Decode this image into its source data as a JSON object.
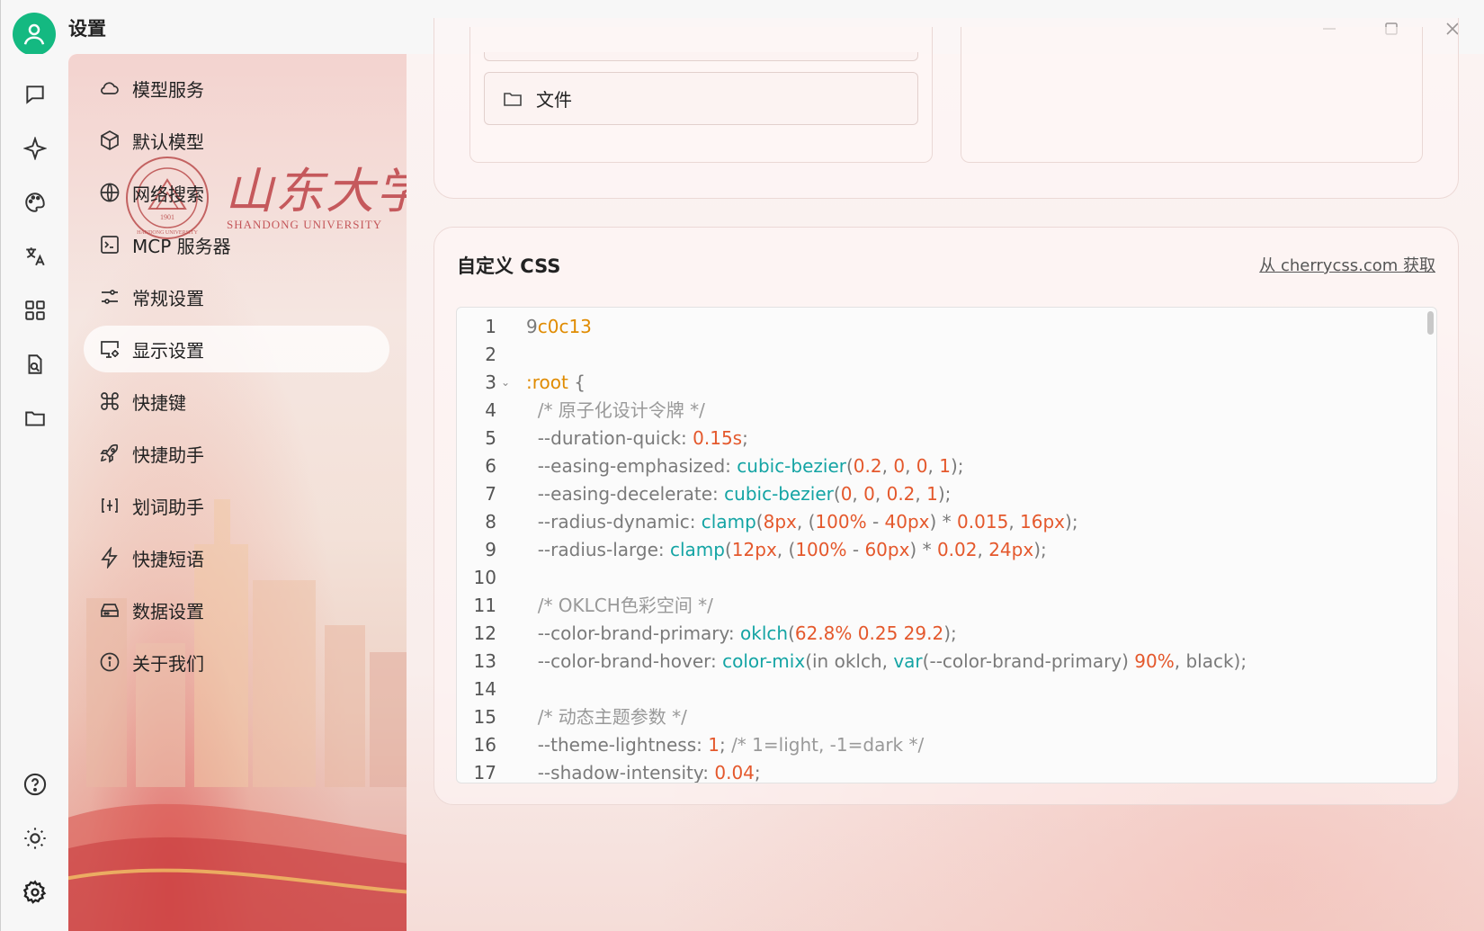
{
  "window": {
    "title": "设置",
    "controls": [
      "minimize-icon",
      "maximize-icon",
      "close-icon"
    ]
  },
  "rail": {
    "top_icons": [
      "chat-icon",
      "sparkle-icon",
      "palette-icon",
      "translate-icon",
      "apps-grid-icon",
      "document-search-icon",
      "folder-icon"
    ],
    "bottom_icons": [
      "help-icon",
      "sun-icon",
      "gear-icon"
    ]
  },
  "nav": {
    "logo_text_cn": "山东大学",
    "logo_text_en": "SHANDONG UNIVERSITY",
    "logo_seal_year": "1901",
    "logo_seal_text": "HANDONG UNIVERSITY",
    "items": [
      {
        "label": "模型服务",
        "icon": "cloud-icon"
      },
      {
        "label": "默认模型",
        "icon": "cube-icon"
      },
      {
        "label": "网络搜索",
        "icon": "globe-icon"
      },
      {
        "label": "MCP 服务器",
        "icon": "terminal-icon"
      },
      {
        "label": "常规设置",
        "icon": "sliders-icon"
      },
      {
        "label": "显示设置",
        "icon": "monitor-settings-icon",
        "active": true
      },
      {
        "label": "快捷键",
        "icon": "command-icon"
      },
      {
        "label": "快捷助手",
        "icon": "rocket-icon"
      },
      {
        "label": "划词助手",
        "icon": "text-select-icon"
      },
      {
        "label": "快捷短语",
        "icon": "zap-icon"
      },
      {
        "label": "数据设置",
        "icon": "hard-drive-icon"
      },
      {
        "label": "关于我们",
        "icon": "info-icon"
      }
    ]
  },
  "top_section": {
    "files_label": "文件"
  },
  "custom_css": {
    "title": "自定义 CSS",
    "link_label": "从 cherrycss.com 获取",
    "lines": [
      {
        "n": "1",
        "parts": [
          [
            "",
            "9"
          ],
          [
            "sel",
            "c0c13"
          ]
        ]
      },
      {
        "n": "2",
        "parts": []
      },
      {
        "n": "3",
        "fold": true,
        "parts": [
          [
            "sel",
            ":root"
          ],
          [
            "",
            " {"
          ]
        ]
      },
      {
        "n": "4",
        "parts": [
          [
            "cm",
            "  /* 原子化设计令牌 */"
          ]
        ]
      },
      {
        "n": "5",
        "parts": [
          [
            "",
            "  --duration-quick: "
          ],
          [
            "num",
            "0.15s"
          ],
          [
            "",
            ";"
          ]
        ]
      },
      {
        "n": "6",
        "parts": [
          [
            "",
            "  --easing-emphasized: "
          ],
          [
            "fn",
            "cubic-bezier"
          ],
          [
            "",
            "("
          ],
          [
            "num",
            "0.2"
          ],
          [
            "",
            ", "
          ],
          [
            "num",
            "0"
          ],
          [
            "",
            ", "
          ],
          [
            "num",
            "0"
          ],
          [
            "",
            ", "
          ],
          [
            "num",
            "1"
          ],
          [
            "",
            ");"
          ]
        ]
      },
      {
        "n": "7",
        "parts": [
          [
            "",
            "  --easing-decelerate: "
          ],
          [
            "fn",
            "cubic-bezier"
          ],
          [
            "",
            "("
          ],
          [
            "num",
            "0"
          ],
          [
            "",
            ", "
          ],
          [
            "num",
            "0"
          ],
          [
            "",
            ", "
          ],
          [
            "num",
            "0.2"
          ],
          [
            "",
            ", "
          ],
          [
            "num",
            "1"
          ],
          [
            "",
            ");"
          ]
        ]
      },
      {
        "n": "8",
        "parts": [
          [
            "",
            "  --radius-dynamic: "
          ],
          [
            "fn",
            "clamp"
          ],
          [
            "",
            "("
          ],
          [
            "num",
            "8px"
          ],
          [
            "",
            ", ("
          ],
          [
            "num",
            "100%"
          ],
          [
            "",
            " - "
          ],
          [
            "num",
            "40px"
          ],
          [
            "",
            ") * "
          ],
          [
            "num",
            "0.015"
          ],
          [
            "",
            ", "
          ],
          [
            "num",
            "16px"
          ],
          [
            "",
            ");"
          ]
        ]
      },
      {
        "n": "9",
        "parts": [
          [
            "",
            "  --radius-large: "
          ],
          [
            "fn",
            "clamp"
          ],
          [
            "",
            "("
          ],
          [
            "num",
            "12px"
          ],
          [
            "",
            ", ("
          ],
          [
            "num",
            "100%"
          ],
          [
            "",
            " - "
          ],
          [
            "num",
            "60px"
          ],
          [
            "",
            ") * "
          ],
          [
            "num",
            "0.02"
          ],
          [
            "",
            ", "
          ],
          [
            "num",
            "24px"
          ],
          [
            "",
            ");"
          ]
        ]
      },
      {
        "n": "10",
        "parts": []
      },
      {
        "n": "11",
        "parts": [
          [
            "cm",
            "  /* OKLCH色彩空间 */"
          ]
        ]
      },
      {
        "n": "12",
        "parts": [
          [
            "",
            "  --color-brand-primary: "
          ],
          [
            "fn",
            "oklch"
          ],
          [
            "",
            "("
          ],
          [
            "num",
            "62.8%"
          ],
          [
            "",
            " "
          ],
          [
            "num",
            "0.25"
          ],
          [
            "",
            " "
          ],
          [
            "num",
            "29.2"
          ],
          [
            "",
            ");"
          ]
        ]
      },
      {
        "n": "13",
        "parts": [
          [
            "",
            "  --color-brand-hover: "
          ],
          [
            "fn",
            "color-mix"
          ],
          [
            "",
            "(in oklch, "
          ],
          [
            "fn",
            "var"
          ],
          [
            "",
            "(--color-brand-primary) "
          ],
          [
            "num",
            "90%"
          ],
          [
            "",
            ", black);"
          ]
        ]
      },
      {
        "n": "14",
        "parts": []
      },
      {
        "n": "15",
        "parts": [
          [
            "cm",
            "  /* 动态主题参数 */"
          ]
        ]
      },
      {
        "n": "16",
        "parts": [
          [
            "",
            "  --theme-lightness: "
          ],
          [
            "num",
            "1"
          ],
          [
            "",
            "; "
          ],
          [
            "cm",
            "/* 1=light, -1=dark */"
          ]
        ]
      },
      {
        "n": "17",
        "parts": [
          [
            "",
            "  --shadow-intensity: "
          ],
          [
            "num",
            "0.04"
          ],
          [
            "",
            ";"
          ]
        ]
      }
    ]
  },
  "colors": {
    "accent_green": "#14b981",
    "code_number": "#e4582c",
    "code_function": "#14a4a4",
    "code_selector": "#e08b00"
  }
}
